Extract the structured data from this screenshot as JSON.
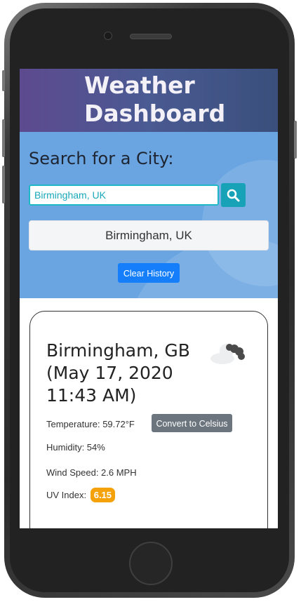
{
  "header": {
    "title": "Weather Dashboard"
  },
  "search": {
    "heading": "Search for a City:",
    "input_value": "Birmingham, UK",
    "history": [
      "Birmingham, UK"
    ],
    "clear_label": "Clear History"
  },
  "current": {
    "title": "Birmingham, GB (May 17, 2020 11:43 AM)",
    "icon": "cloudy-icon",
    "temperature_label": "Temperature: 59.72°F",
    "convert_label": "Convert to Celsius",
    "humidity_label": "Humidity: 54%",
    "wind_label": "Wind Speed: 2.6 MPH",
    "uv_label": "UV Index:",
    "uv_value": "6.15",
    "uv_color": "#f5a10a"
  },
  "colors": {
    "header": "#4a5a92",
    "search_bg": "#6aa5e2",
    "accent": "#17a2b8",
    "primary": "#157ffb"
  }
}
